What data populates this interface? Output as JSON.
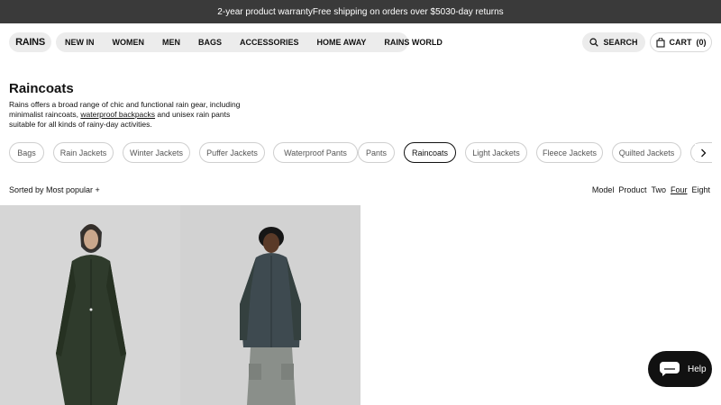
{
  "announcement": {
    "text": "2-year product warrantyFree shipping on orders over $5030-day returns"
  },
  "header": {
    "logo": "RAINS",
    "nav": [
      "NEW IN",
      "WOMEN",
      "MEN",
      "BAGS",
      "ACCESSORIES",
      "HOME AWAY",
      "RAINS WORLD"
    ],
    "search_label": "SEARCH",
    "cart_label": "CART",
    "cart_count": "(0)"
  },
  "page": {
    "title": "Raincoats",
    "desc_before": "Rains offers a broad range of chic and functional rain gear, including minimalist raincoats, ",
    "desc_link": "waterproof backpacks",
    "desc_after": " and unisex rain pants suitable for all kinds of rainy-day activities."
  },
  "categories": [
    {
      "label": "Bags",
      "active": false
    },
    {
      "label": "Rain Jackets",
      "active": false
    },
    {
      "label": "Winter Jackets",
      "active": false
    },
    {
      "label": "Puffer Jackets",
      "active": false
    },
    {
      "label": "Waterproof Pants",
      "active": false
    },
    {
      "label": "Pants",
      "active": false
    },
    {
      "label": "Raincoats",
      "active": true
    },
    {
      "label": "Light Jackets",
      "active": false
    },
    {
      "label": "Fleece Jackets",
      "active": false
    },
    {
      "label": "Quilted Jackets",
      "active": false
    },
    {
      "label": "",
      "active": false
    }
  ],
  "sort": {
    "label": "Sorted by Most popular +"
  },
  "view": {
    "options": [
      "Model",
      "Product",
      "Two",
      "Four",
      "Eight"
    ],
    "selected": "Four"
  },
  "products": [
    {
      "name": "long-green-raincoat",
      "color": "#2f3b2c"
    },
    {
      "name": "short-slate-rain-jacket",
      "color": "#3e4a50"
    }
  ],
  "help": {
    "label": "Help"
  },
  "colors": {
    "announcement_bg": "#3a3a3a",
    "pill_bg": "#ececec",
    "product_bg": "#d4d4d4",
    "help_bg": "#111111"
  }
}
